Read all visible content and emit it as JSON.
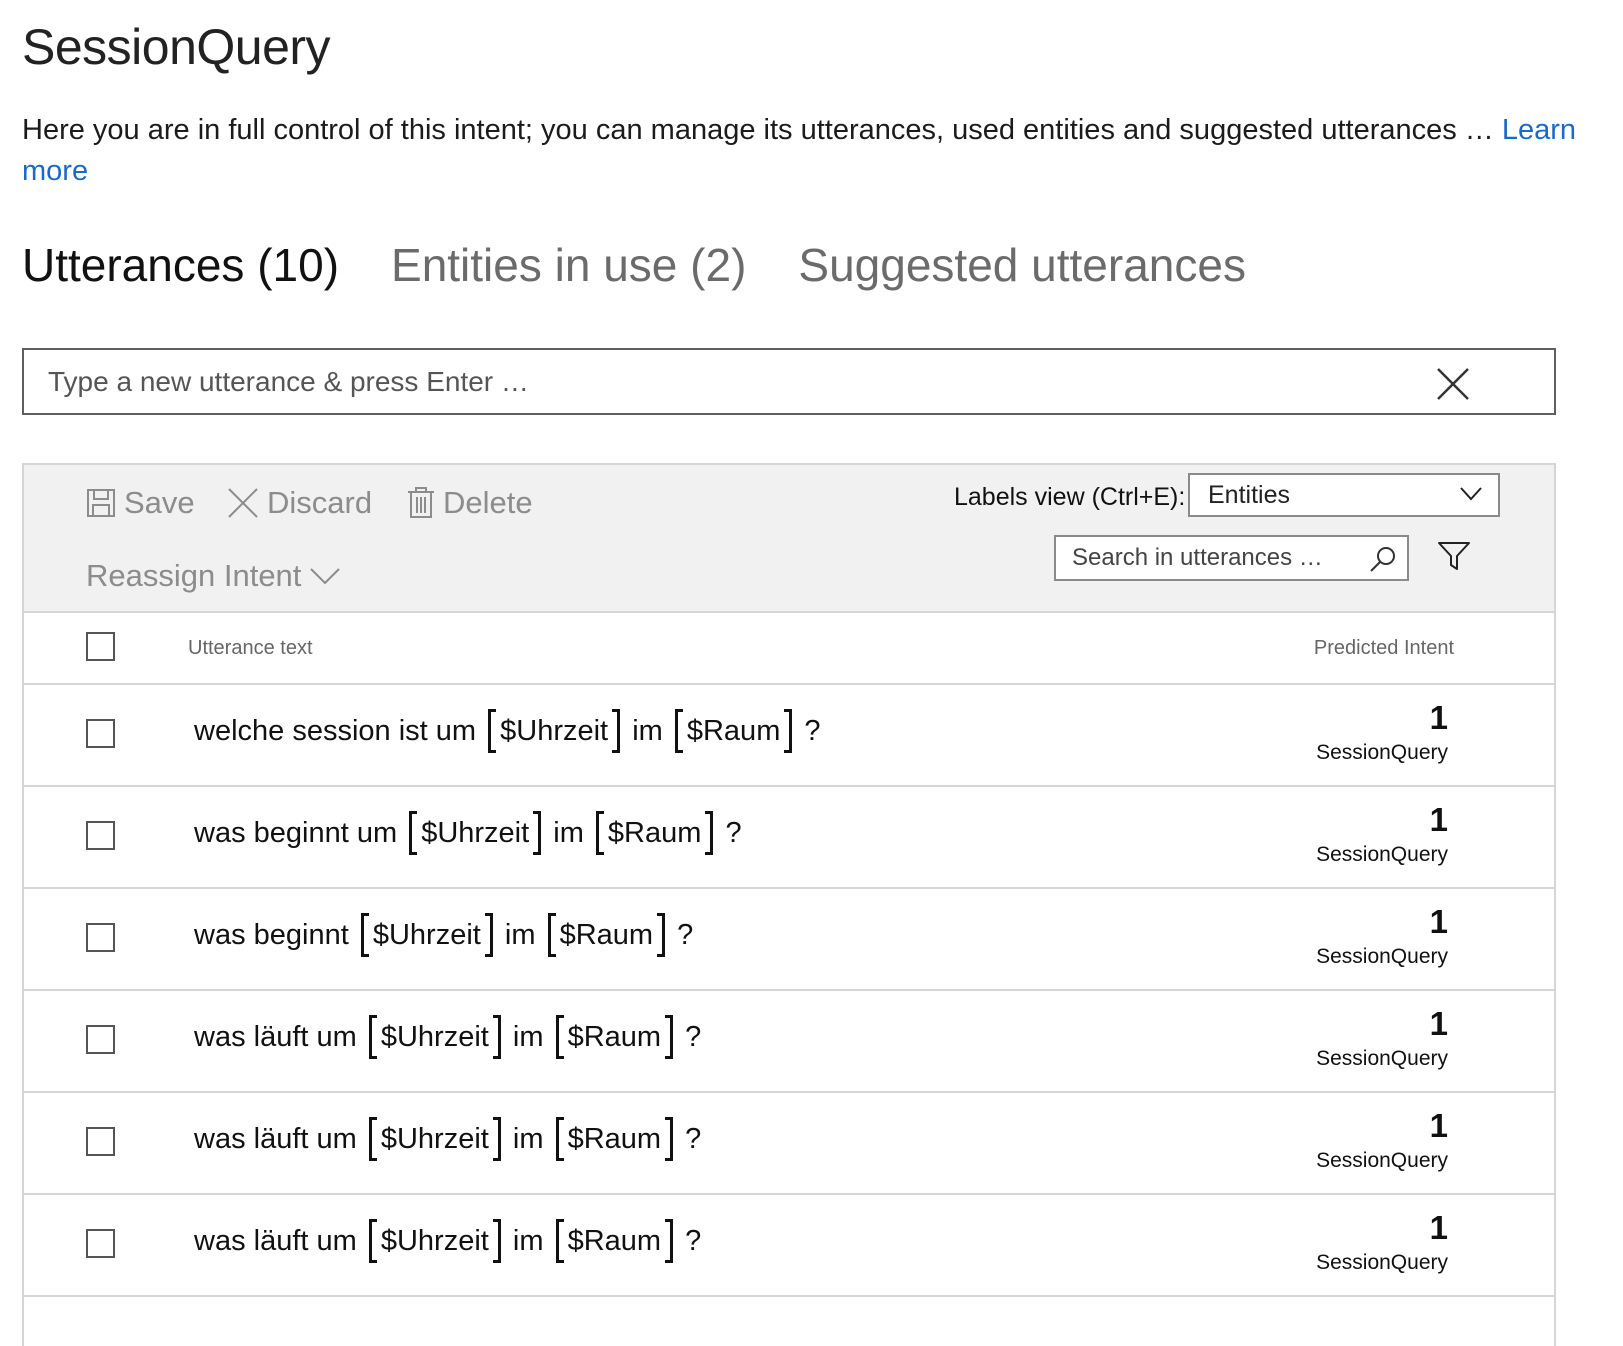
{
  "page": {
    "title": "SessionQuery",
    "description": "Here you are in full control of this intent; you can manage its utterances, used entities and suggested utterances … ",
    "learn_more": "Learn more"
  },
  "tabs": [
    {
      "label": "Utterances (10)",
      "active": true
    },
    {
      "label": "Entities in use (2)",
      "active": false
    },
    {
      "label": "Suggested utterances",
      "active": false
    }
  ],
  "new_utterance": {
    "placeholder": "Type a new utterance & press Enter …",
    "value": ""
  },
  "toolbar": {
    "save_label": "Save",
    "discard_label": "Discard",
    "delete_label": "Delete",
    "reassign_label": "Reassign Intent",
    "labels_view_label": "Labels view (Ctrl+E):",
    "labels_view_value": "Entities",
    "search_placeholder": "Search in utterances …"
  },
  "table": {
    "columns": {
      "text": "Utterance text",
      "intent": "Predicted Intent"
    },
    "rows": [
      {
        "parts": [
          "welche session ist um",
          "$Uhrzeit",
          "im",
          "$Raum",
          "?"
        ],
        "score": "1",
        "intent": "SessionQuery"
      },
      {
        "parts": [
          "was beginnt um",
          "$Uhrzeit",
          "im",
          "$Raum",
          "?"
        ],
        "score": "1",
        "intent": "SessionQuery"
      },
      {
        "parts": [
          "was beginnt",
          "$Uhrzeit",
          "im",
          "$Raum",
          "?"
        ],
        "score": "1",
        "intent": "SessionQuery"
      },
      {
        "parts": [
          "was läuft um",
          "$Uhrzeit",
          "im",
          "$Raum",
          "?"
        ],
        "score": "1",
        "intent": "SessionQuery"
      },
      {
        "parts": [
          "was läuft um",
          "$Uhrzeit",
          "im",
          "$Raum",
          "?"
        ],
        "score": "1",
        "intent": "SessionQuery"
      },
      {
        "parts": [
          "was läuft um",
          "$Uhrzeit",
          "im",
          "$Raum",
          "?"
        ],
        "score": "1",
        "intent": "SessionQuery"
      }
    ]
  },
  "colors": {
    "link": "#1b6ac9",
    "toolbar_bg": "#f1f1f1",
    "disabled_text": "#8c8c8c"
  }
}
